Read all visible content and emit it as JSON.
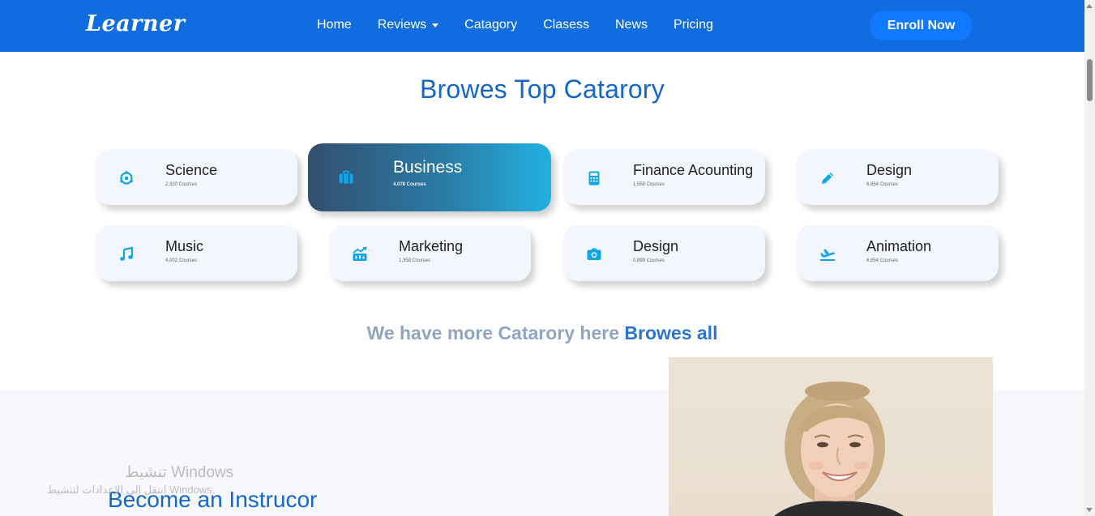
{
  "navbar": {
    "logo": "Learner",
    "links": [
      {
        "label": "Home"
      },
      {
        "label": "Reviews",
        "has_dropdown": true
      },
      {
        "label": "Catagory"
      },
      {
        "label": "Clasess"
      },
      {
        "label": "News"
      },
      {
        "label": "Pricing"
      }
    ],
    "cta_label": "Enroll Now",
    "background_color": "#116ddf"
  },
  "categories": {
    "title": "Browes Top Catarory",
    "items": [
      {
        "name": "Science",
        "count": "2,320 Courses",
        "icon": "atom-icon"
      },
      {
        "name": "Business",
        "count": "4,078 Courses",
        "icon": "briefcase-icon",
        "active": true
      },
      {
        "name": "Finance Acounting",
        "count": "1,558 Courses",
        "icon": "calculator-icon"
      },
      {
        "name": "Design",
        "count": "6,854 Courses",
        "icon": "pencil-icon"
      },
      {
        "name": "Music",
        "count": "4,002 Courses",
        "icon": "music-note-icon"
      },
      {
        "name": "Marketing",
        "count": "1,358 Courses",
        "icon": "chart-icon"
      },
      {
        "name": "Design",
        "count": "0,899 Courses",
        "icon": "camera-icon"
      },
      {
        "name": "Animation",
        "count": "6,854 Courses",
        "icon": "plane-icon"
      }
    ],
    "more_text": "We have more Catarory here",
    "more_link": "Browes all"
  },
  "instructor": {
    "title": "Become an Instrucor"
  },
  "windows_watermark": {
    "line1": "تنشيط Windows",
    "line2": "انتقل إلى الإعدادات لتنشيط Windows."
  },
  "colors": {
    "accent": "#1566cb",
    "icon": "#0ea5e9",
    "card_bg": "#f3f6fd"
  }
}
